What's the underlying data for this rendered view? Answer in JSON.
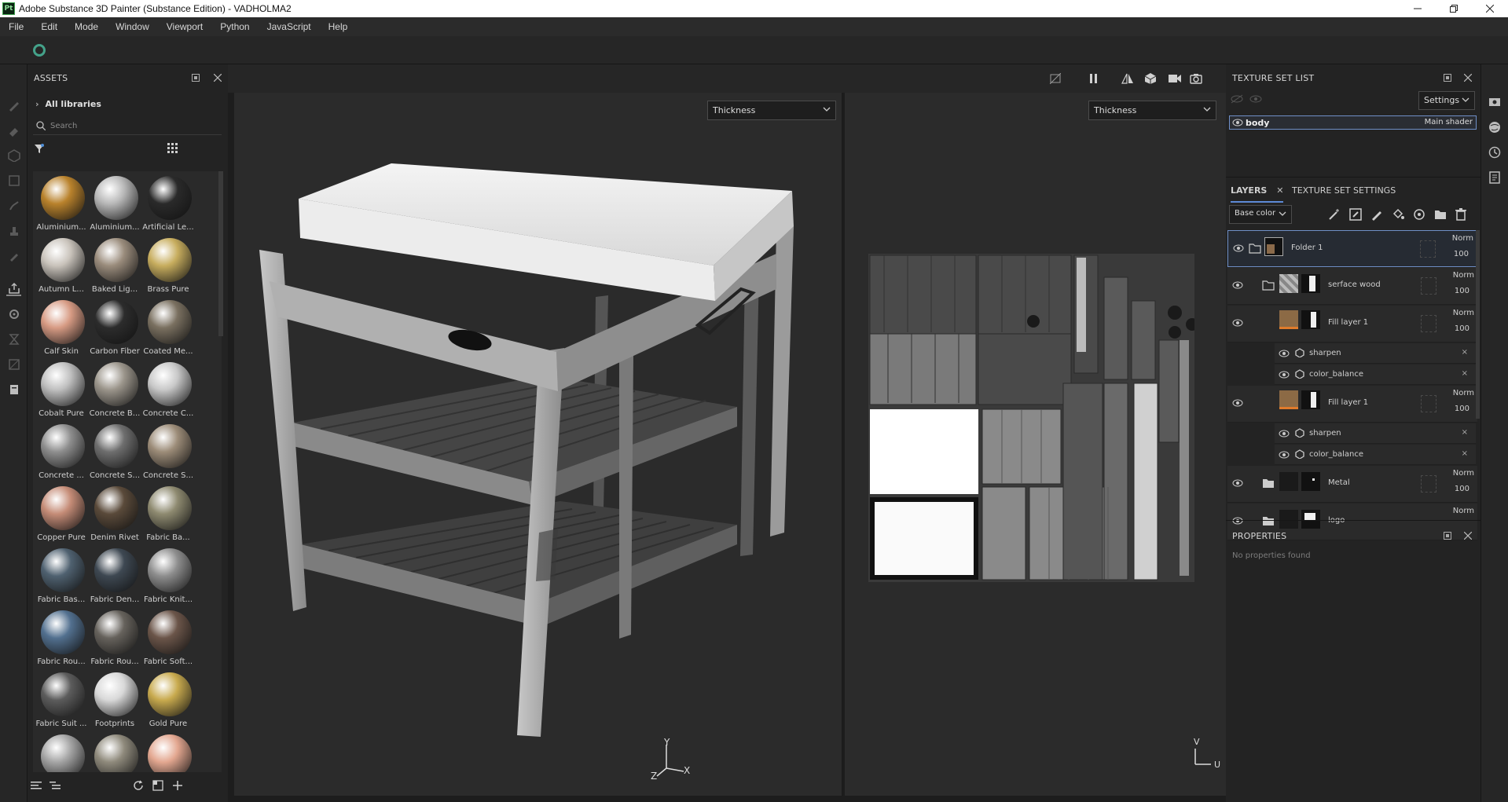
{
  "window": {
    "title": "Adobe Substance 3D Painter (Substance Edition) - VADHOLMA2",
    "logo": "Pt"
  },
  "menu": [
    "File",
    "Edit",
    "Mode",
    "Window",
    "Viewport",
    "Python",
    "JavaScript",
    "Help"
  ],
  "assets": {
    "title": "ASSETS",
    "breadcrumb": "All libraries",
    "search_placeholder": "Search",
    "items": [
      {
        "label": "Aluminium...",
        "color": "#b9822c",
        "icon": "material-sphere"
      },
      {
        "label": "Aluminium...",
        "color": "#b8b8b8",
        "icon": "material-sphere"
      },
      {
        "label": "Artificial Le...",
        "color": "#2a2a2a",
        "icon": "material-sphere"
      },
      {
        "label": "Autumn L...",
        "color": "#c9c3bb",
        "icon": "leaf-decal"
      },
      {
        "label": "Baked Lig...",
        "color": "#9a8c7c",
        "icon": "material-sphere"
      },
      {
        "label": "Brass Pure",
        "color": "#c7ad5e",
        "icon": "material-sphere"
      },
      {
        "label": "Calf Skin",
        "color": "#d79b84",
        "icon": "material-sphere"
      },
      {
        "label": "Carbon Fiber",
        "color": "#2c2c2c",
        "icon": "material-sphere"
      },
      {
        "label": "Coated Me...",
        "color": "#7a7060",
        "icon": "material-sphere"
      },
      {
        "label": "Cobalt Pure",
        "color": "#bfbfbf",
        "icon": "material-sphere"
      },
      {
        "label": "Concrete B...",
        "color": "#9b958b",
        "icon": "material-sphere"
      },
      {
        "label": "Concrete C...",
        "color": "#c8c8c8",
        "icon": "material-sphere"
      },
      {
        "label": "Concrete ...",
        "color": "#8e8e8e",
        "icon": "material-sphere"
      },
      {
        "label": "Concrete S...",
        "color": "#6e6e6e",
        "icon": "material-sphere"
      },
      {
        "label": "Concrete S...",
        "color": "#9c8c78",
        "icon": "material-sphere"
      },
      {
        "label": "Copper Pure",
        "color": "#c58c77",
        "icon": "material-sphere"
      },
      {
        "label": "Denim Rivet",
        "color": "#5a4a3a",
        "icon": "material-sphere"
      },
      {
        "label": "Fabric Ba...",
        "color": "#8e8a70",
        "icon": "material-sphere"
      },
      {
        "label": "Fabric Bas...",
        "color": "#4f6170",
        "icon": "material-sphere"
      },
      {
        "label": "Fabric Den...",
        "color": "#3e4852",
        "icon": "material-sphere"
      },
      {
        "label": "Fabric Knit...",
        "color": "#8e8e8e",
        "icon": "material-sphere"
      },
      {
        "label": "Fabric Rou...",
        "color": "#52708f",
        "icon": "material-sphere"
      },
      {
        "label": "Fabric Rou...",
        "color": "#66625c",
        "icon": "material-sphere"
      },
      {
        "label": "Fabric Soft...",
        "color": "#6b5549",
        "icon": "material-sphere"
      },
      {
        "label": "Fabric Suit ...",
        "color": "#5c5c5c",
        "icon": "material-sphere"
      },
      {
        "label": "Footprints",
        "color": "#d8d8d8",
        "icon": "material-sphere"
      },
      {
        "label": "Gold Pure",
        "color": "#c8aa4e",
        "icon": "material-sphere"
      },
      {
        "label": "",
        "color": "#a5a5a5",
        "icon": "material-sphere"
      },
      {
        "label": "",
        "color": "#8f8a7c",
        "icon": "material-sphere"
      },
      {
        "label": "",
        "color": "#e3a790",
        "icon": "material-sphere"
      }
    ]
  },
  "viewport": {
    "left_channel": "Thickness",
    "right_channel": "Thickness",
    "axes_3d": [
      "Y",
      "Z",
      "X"
    ],
    "axes_2d": [
      "V",
      "U"
    ]
  },
  "texture_set_list": {
    "title": "TEXTURE SET LIST",
    "settings_label": "Settings",
    "set_name": "body",
    "shader": "Main shader"
  },
  "layers": {
    "tab_layers": "LAYERS",
    "tab_texture_settings": "TEXTURE SET SETTINGS",
    "channel": "Base color",
    "rows": [
      {
        "name": "Folder 1",
        "blend": "Norm",
        "opacity": "100"
      },
      {
        "name": "serface wood",
        "blend": "Norm",
        "opacity": "100"
      },
      {
        "name": "Fill layer 1",
        "blend": "Norm",
        "opacity": "100"
      },
      {
        "name": "Fill layer 1",
        "blend": "Norm",
        "opacity": "100"
      },
      {
        "name": "Metal",
        "blend": "Norm",
        "opacity": "100"
      },
      {
        "name": "logo",
        "blend": "Norm",
        "opacity": ""
      }
    ],
    "filters_a": [
      "sharpen",
      "color_balance"
    ],
    "filters_b": [
      "sharpen",
      "color_balance"
    ]
  },
  "properties": {
    "title": "PROPERTIES",
    "empty_text": "No properties found"
  }
}
